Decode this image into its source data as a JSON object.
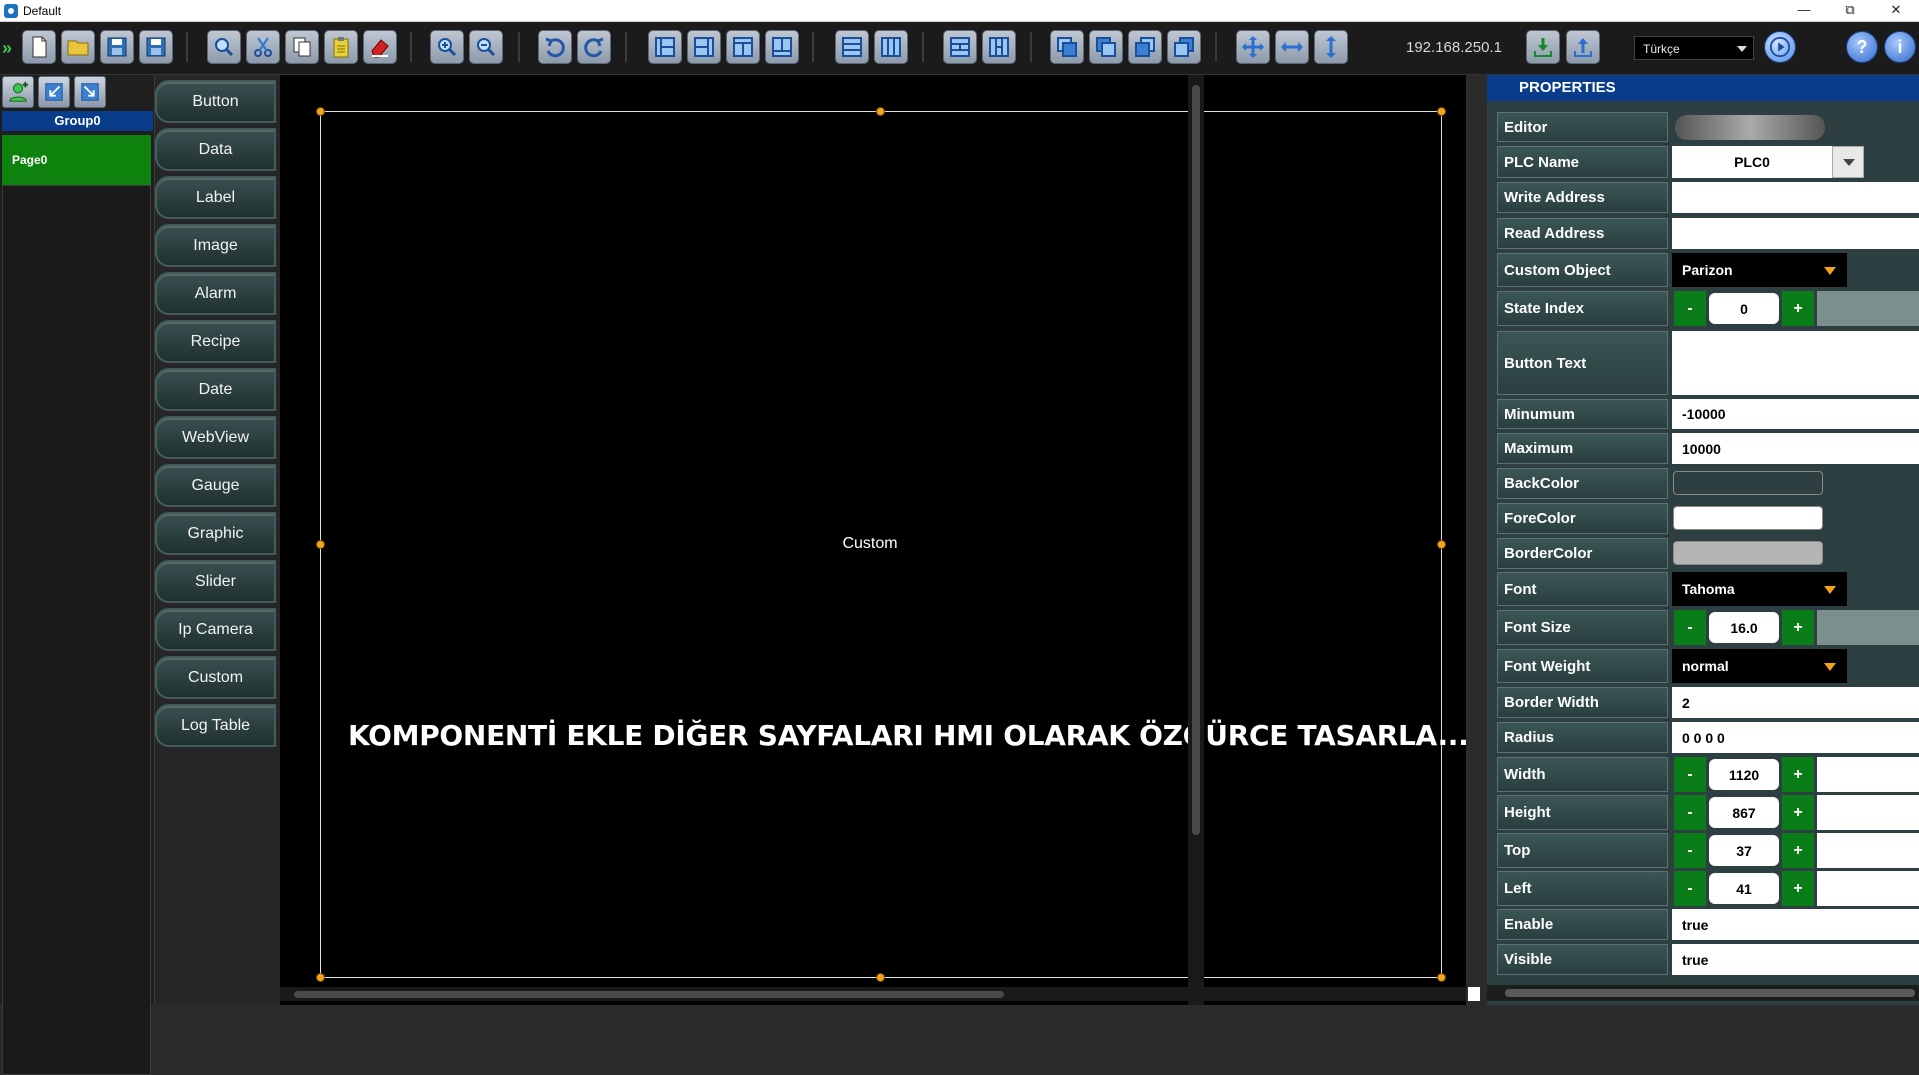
{
  "window": {
    "title": "Default",
    "minimize": "—",
    "restore": "⧉",
    "close": "✕"
  },
  "toolbar": {
    "expand_icon": "»",
    "ip_address": "192.168.250.1",
    "language": "Türkçe",
    "help_label": "?",
    "info_label": "i"
  },
  "pages_panel": {
    "group": "Group0",
    "pages": [
      "Page0"
    ]
  },
  "palette": {
    "items": [
      "Button",
      "Data",
      "Label",
      "Image",
      "Alarm",
      "Recipe",
      "Date",
      "WebView",
      "Gauge",
      "Graphic",
      "Slider",
      "Ip Camera",
      "Custom",
      "Log Table"
    ]
  },
  "canvas": {
    "object_label": "Custom",
    "headline": "KOMPONENTİ EKLE DİĞER SAYFALARI HMI OLARAK ÖZGÜRCE TASARLA..."
  },
  "properties": {
    "header": "PROPERTIES",
    "labels": {
      "editor": "Editor",
      "plc_name": "PLC Name",
      "write_address": "Write Address",
      "read_address": "Read Address",
      "custom_object": "Custom Object",
      "state_index": "State Index",
      "button_text": "Button Text",
      "minimum": "Minumum",
      "maximum": "Maximum",
      "backcolor": "BackColor",
      "forecolor": "ForeColor",
      "bordercolor": "BorderColor",
      "font": "Font",
      "font_size": "Font Size",
      "font_weight": "Font Weight",
      "border_width": "Border Width",
      "radius": "Radius",
      "width": "Width",
      "height": "Height",
      "top": "Top",
      "left": "Left",
      "enable": "Enable",
      "visible": "Visible"
    },
    "values": {
      "plc_name": "PLC0",
      "write_address": "",
      "read_address": "",
      "custom_object": "Parizon",
      "state_index": "0",
      "button_text": "",
      "minimum": "-10000",
      "maximum": "10000",
      "font": "Tahoma",
      "font_size": "16.0",
      "font_weight": "normal",
      "border_width": "2",
      "radius": "0 0 0 0",
      "width": "1120",
      "height": "867",
      "top": "37",
      "left": "41",
      "enable": "true",
      "visible": "true"
    },
    "minus": "-",
    "plus": "+",
    "colors": {
      "backcolor": "#2d3f40",
      "forecolor": "#ffffff",
      "bordercolor": "#b5b5b5"
    }
  }
}
